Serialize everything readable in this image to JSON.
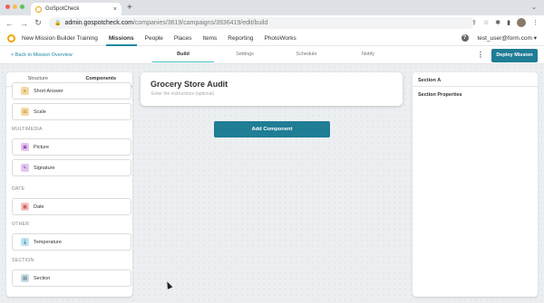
{
  "browser": {
    "tab_title": "GoSpotCheck",
    "tab_close": "×",
    "new_tab": "+",
    "url_host": "admin.gospotcheck.com",
    "url_path": "/companies/3619/campaigns/3936419/edit/build"
  },
  "header": {
    "app_title": "New Mission Builder Training",
    "nav": [
      "Missions",
      "People",
      "Places",
      "Items",
      "Reporting",
      "PhotoWorks"
    ],
    "active_nav": "Missions",
    "help": "?",
    "user": "test_user@form.com ▾"
  },
  "subnav": {
    "back": "< Back to Mission Overview",
    "tabs": [
      "Build",
      "Settings",
      "Schedule",
      "Notify"
    ],
    "more": "⋮",
    "deploy": "Deploy Mission"
  },
  "left_panel": {
    "tabs": [
      "Structure",
      "Components"
    ],
    "components": [
      {
        "label": "Short Answer",
        "icon": "text-icon"
      },
      {
        "label": "Scale",
        "icon": "scale-icon"
      }
    ],
    "sections": [
      {
        "name": "MULTIMEDIA",
        "items": [
          {
            "label": "Picture",
            "icon": "picture-icon"
          },
          {
            "label": "Signature",
            "icon": "signature-icon"
          }
        ]
      },
      {
        "name": "DATE",
        "items": [
          {
            "label": "Date",
            "icon": "calendar-icon"
          }
        ]
      },
      {
        "name": "OTHER",
        "items": [
          {
            "label": "Temperature",
            "icon": "thermometer-icon"
          }
        ]
      },
      {
        "name": "SECTION",
        "items": [
          {
            "label": "Section",
            "icon": "section-icon"
          }
        ]
      }
    ]
  },
  "card": {
    "title": "Grocery Store Audit",
    "placeholder": "Enter the instructions (optional)"
  },
  "add_component": "Add Component",
  "right_panel": {
    "title": "Section A",
    "subtitle": "Section Properties"
  },
  "colors": {
    "accent": "#1f7d95",
    "teal": "#3cc1c9",
    "logo": "#f0a500"
  }
}
